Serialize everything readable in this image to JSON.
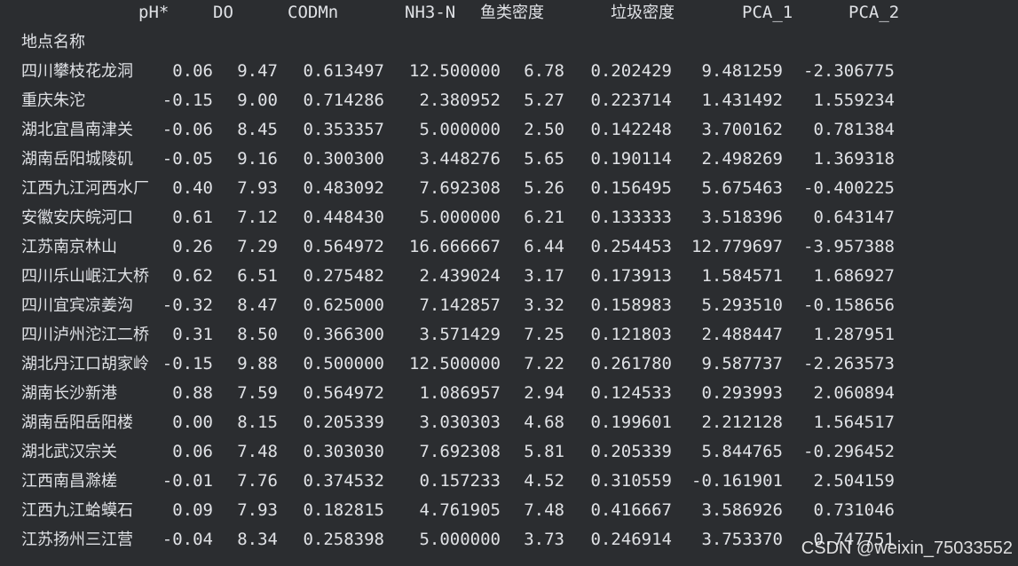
{
  "columns": [
    "pH*",
    "DO",
    "CODMn",
    "NH3-N",
    "鱼类密度",
    "垃圾密度",
    "PCA_1",
    "PCA_2"
  ],
  "index_label": "地点名称",
  "rows": [
    {
      "name": "四川攀枝花龙洞",
      "ph": "0.06",
      "do": "9.47",
      "codmn": "0.613497",
      "nh3n": "12.500000",
      "fish": "6.78",
      "trash": "0.202429",
      "pca1": "9.481259",
      "pca2": "-2.306775"
    },
    {
      "name": "重庆朱沱",
      "ph": "-0.15",
      "do": "9.00",
      "codmn": "0.714286",
      "nh3n": "2.380952",
      "fish": "5.27",
      "trash": "0.223714",
      "pca1": "1.431492",
      "pca2": "1.559234"
    },
    {
      "name": "湖北宜昌南津关",
      "ph": "-0.06",
      "do": "8.45",
      "codmn": "0.353357",
      "nh3n": "5.000000",
      "fish": "2.50",
      "trash": "0.142248",
      "pca1": "3.700162",
      "pca2": "0.781384"
    },
    {
      "name": "湖南岳阳城陵矶",
      "ph": "-0.05",
      "do": "9.16",
      "codmn": "0.300300",
      "nh3n": "3.448276",
      "fish": "5.65",
      "trash": "0.190114",
      "pca1": "2.498269",
      "pca2": "1.369318"
    },
    {
      "name": "江西九江河西水厂",
      "ph": "0.40",
      "do": "7.93",
      "codmn": "0.483092",
      "nh3n": "7.692308",
      "fish": "5.26",
      "trash": "0.156495",
      "pca1": "5.675463",
      "pca2": "-0.400225"
    },
    {
      "name": "安徽安庆皖河口",
      "ph": "0.61",
      "do": "7.12",
      "codmn": "0.448430",
      "nh3n": "5.000000",
      "fish": "6.21",
      "trash": "0.133333",
      "pca1": "3.518396",
      "pca2": "0.643147"
    },
    {
      "name": "江苏南京林山",
      "ph": "0.26",
      "do": "7.29",
      "codmn": "0.564972",
      "nh3n": "16.666667",
      "fish": "6.44",
      "trash": "0.254453",
      "pca1": "12.779697",
      "pca2": "-3.957388"
    },
    {
      "name": "四川乐山岷江大桥",
      "ph": "0.62",
      "do": "6.51",
      "codmn": "0.275482",
      "nh3n": "2.439024",
      "fish": "3.17",
      "trash": "0.173913",
      "pca1": "1.584571",
      "pca2": "1.686927"
    },
    {
      "name": "四川宜宾凉姜沟",
      "ph": "-0.32",
      "do": "8.47",
      "codmn": "0.625000",
      "nh3n": "7.142857",
      "fish": "3.32",
      "trash": "0.158983",
      "pca1": "5.293510",
      "pca2": "-0.158656"
    },
    {
      "name": "四川泸州沱江二桥",
      "ph": "0.31",
      "do": "8.50",
      "codmn": "0.366300",
      "nh3n": "3.571429",
      "fish": "7.25",
      "trash": "0.121803",
      "pca1": "2.488447",
      "pca2": "1.287951"
    },
    {
      "name": "湖北丹江口胡家岭",
      "ph": "-0.15",
      "do": "9.88",
      "codmn": "0.500000",
      "nh3n": "12.500000",
      "fish": "7.22",
      "trash": "0.261780",
      "pca1": "9.587737",
      "pca2": "-2.263573"
    },
    {
      "name": "湖南长沙新港",
      "ph": "0.88",
      "do": "7.59",
      "codmn": "0.564972",
      "nh3n": "1.086957",
      "fish": "2.94",
      "trash": "0.124533",
      "pca1": "0.293993",
      "pca2": "2.060894"
    },
    {
      "name": "湖南岳阳岳阳楼",
      "ph": "0.00",
      "do": "8.15",
      "codmn": "0.205339",
      "nh3n": "3.030303",
      "fish": "4.68",
      "trash": "0.199601",
      "pca1": "2.212128",
      "pca2": "1.564517"
    },
    {
      "name": "湖北武汉宗关",
      "ph": "0.06",
      "do": "7.48",
      "codmn": "0.303030",
      "nh3n": "7.692308",
      "fish": "5.81",
      "trash": "0.205339",
      "pca1": "5.844765",
      "pca2": "-0.296452"
    },
    {
      "name": "江西南昌滁槎",
      "ph": "-0.01",
      "do": "7.76",
      "codmn": "0.374532",
      "nh3n": "0.157233",
      "fish": "4.52",
      "trash": "0.310559",
      "pca1": "-0.161901",
      "pca2": "2.504159"
    },
    {
      "name": "江西九江蛤蟆石",
      "ph": "0.09",
      "do": "7.93",
      "codmn": "0.182815",
      "nh3n": "4.761905",
      "fish": "7.48",
      "trash": "0.416667",
      "pca1": "3.586926",
      "pca2": "0.731046"
    },
    {
      "name": "江苏扬州三江营",
      "ph": "-0.04",
      "do": "8.34",
      "codmn": "0.258398",
      "nh3n": "5.000000",
      "fish": "3.73",
      "trash": "0.246914",
      "pca1": "3.753370",
      "pca2": "0.747751"
    }
  ],
  "watermark": "CSDN @weixin_75033552",
  "colors": {
    "background": "#2b2d30",
    "text": "#dfe1e5"
  }
}
